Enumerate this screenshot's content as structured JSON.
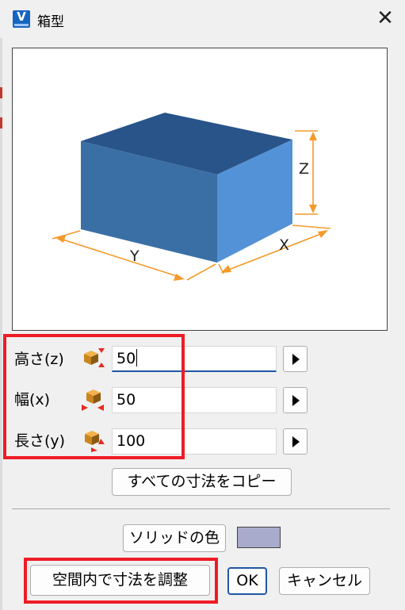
{
  "window": {
    "title": "箱型",
    "app_icon_letter": "V",
    "close_glyph": "✕"
  },
  "preview": {
    "label_z": "Z",
    "label_x": "X",
    "label_y": "Y",
    "colors": {
      "box_front": "#3a6fa6",
      "box_top": "#28548a",
      "box_side": "#5392d6",
      "dimension": "#f39a2a"
    }
  },
  "dimensions": [
    {
      "label": "高さ(z)",
      "value": "50",
      "focused": true
    },
    {
      "label": "幅(x)",
      "value": "50",
      "focused": false
    },
    {
      "label": "長さ(y)",
      "value": "100",
      "focused": false
    }
  ],
  "buttons": {
    "copy_all": "すべての寸法をコピー",
    "solid_color": "ソリッドの色",
    "adjust_in_space": "空間内で寸法を調整",
    "ok": "OK",
    "cancel": "キャンセル"
  },
  "solid_color_value": "#a9abcd",
  "highlight_color": "#ee1c25"
}
